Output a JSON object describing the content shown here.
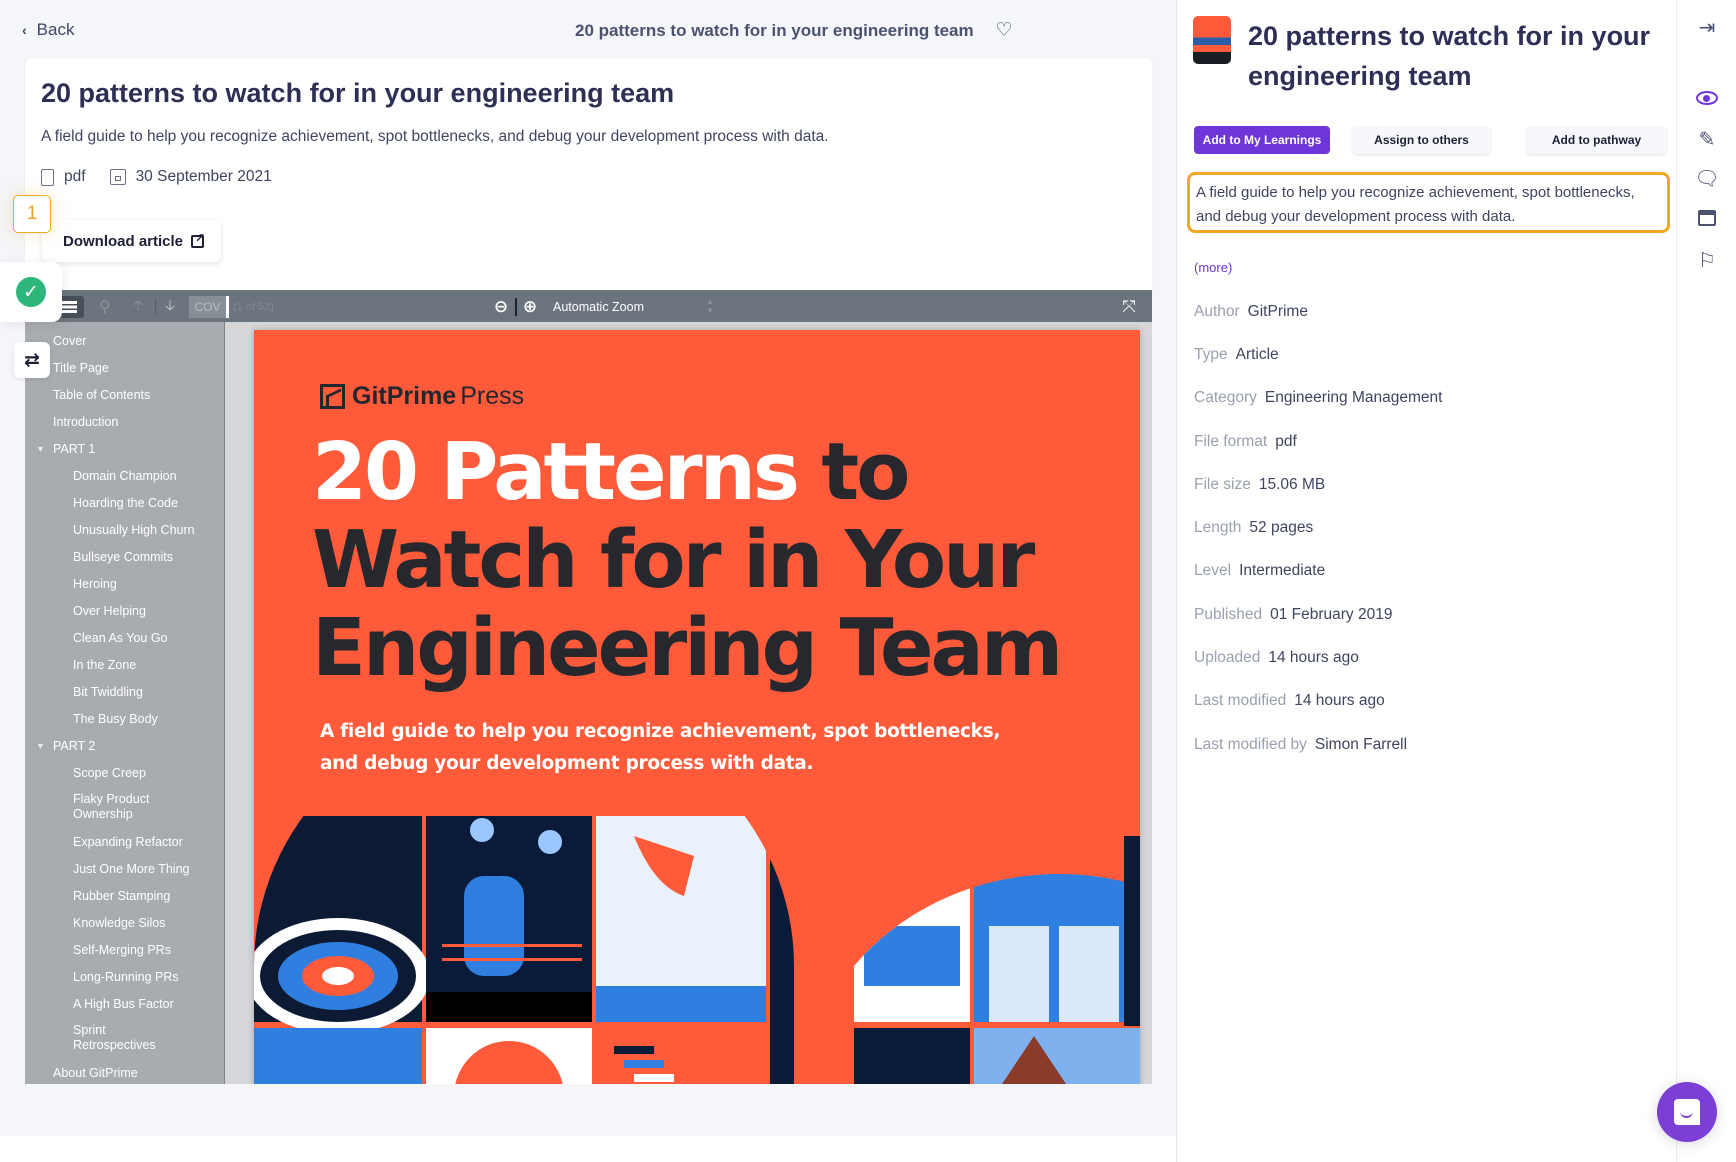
{
  "header": {
    "back_label": "Back",
    "title": "20 patterns to watch for in your engineering team",
    "favorite_icon": "heart-outline-icon"
  },
  "card": {
    "title": "20 patterns to watch for in your engineering team",
    "description": "A field guide to help you recognize achievement, spot bottlenecks, and debug your development process with data.",
    "format": "pdf",
    "date": "30 September 2021",
    "download_label": "Download article"
  },
  "overlays": {
    "step_number": "1"
  },
  "pdf_viewer": {
    "page_input": "COV",
    "page_count": "(1 of 52)",
    "zoom_select": "Automatic Zoom",
    "outline": [
      {
        "label": "Cover",
        "level": 0
      },
      {
        "label": "Title Page",
        "level": 0
      },
      {
        "label": "Table of Contents",
        "level": 0
      },
      {
        "label": "Introduction",
        "level": 0
      },
      {
        "label": "PART 1",
        "level": 0,
        "expanded": true
      },
      {
        "label": "Domain Champion",
        "level": 1
      },
      {
        "label": "Hoarding the Code",
        "level": 1
      },
      {
        "label": "Unusually High Churn",
        "level": 1
      },
      {
        "label": "Bullseye Commits",
        "level": 1
      },
      {
        "label": "Heroing",
        "level": 1
      },
      {
        "label": "Over Helping",
        "level": 1
      },
      {
        "label": "Clean As You Go",
        "level": 1
      },
      {
        "label": "In the Zone",
        "level": 1
      },
      {
        "label": "Bit Twiddling",
        "level": 1
      },
      {
        "label": "The Busy Body",
        "level": 1
      },
      {
        "label": "PART 2",
        "level": 0,
        "expanded": true
      },
      {
        "label": "Scope Creep",
        "level": 1
      },
      {
        "label": "Flaky Product Ownership",
        "level": 1
      },
      {
        "label": "Expanding Refactor",
        "level": 1
      },
      {
        "label": "Just One More Thing",
        "level": 1
      },
      {
        "label": "Rubber Stamping",
        "level": 1
      },
      {
        "label": "Knowledge Silos",
        "level": 1
      },
      {
        "label": "Self-Merging PRs",
        "level": 1
      },
      {
        "label": "Long-Running PRs",
        "level": 1
      },
      {
        "label": "A High Bus Factor",
        "level": 1
      },
      {
        "label": "Sprint Retrospectives",
        "level": 1
      },
      {
        "label": "About GitPrime",
        "level": 0
      }
    ],
    "cover": {
      "publisher_bold": "GitPrime",
      "publisher_light": "Press",
      "title_line1_white": "20 Patterns",
      "title_line1_dark": " to",
      "title_line2": "Watch for in Your",
      "title_line3": "Engineering Team",
      "subtitle_line1": "A field guide to help you recognize achievement, spot bottlenecks,",
      "subtitle_line2": "and debug your development process with data.",
      "colors": {
        "background": "#ff5b3a",
        "dark": "#26282e",
        "blue": "#2f7fe0"
      }
    }
  },
  "details": {
    "title": "20 patterns to watch for in your engineering team",
    "buttons": {
      "add_to_learnings": "Add to My Learnings",
      "assign": "Assign to others",
      "add_to_pathway": "Add to pathway"
    },
    "description": "A field guide to help you recognize achievement, spot bottlenecks, and debug your development process with data.",
    "more_label": "(more)",
    "meta": [
      {
        "key": "Author",
        "value": "GitPrime"
      },
      {
        "key": "Type",
        "value": "Article"
      },
      {
        "key": "Category",
        "value": "Engineering Management"
      },
      {
        "key": "File format",
        "value": "pdf"
      },
      {
        "key": "File size",
        "value": "15.06 MB"
      },
      {
        "key": "Length",
        "value": "52 pages"
      },
      {
        "key": "Level",
        "value": "Intermediate"
      },
      {
        "key": "Published",
        "value": "01 February 2019"
      },
      {
        "key": "Uploaded",
        "value": "14 hours ago"
      },
      {
        "key": "Last modified",
        "value": "14 hours ago"
      },
      {
        "key": "Last modified by",
        "value": "Simon Farrell"
      }
    ]
  },
  "rail": {
    "icons": [
      "collapse-panel-icon",
      "eye-icon",
      "edit-icon",
      "comment-icon",
      "archive-icon",
      "flag-icon"
    ]
  },
  "theme": {
    "accent": "#6e35d9",
    "highlight": "#f5a623",
    "success": "#2fb67c"
  }
}
